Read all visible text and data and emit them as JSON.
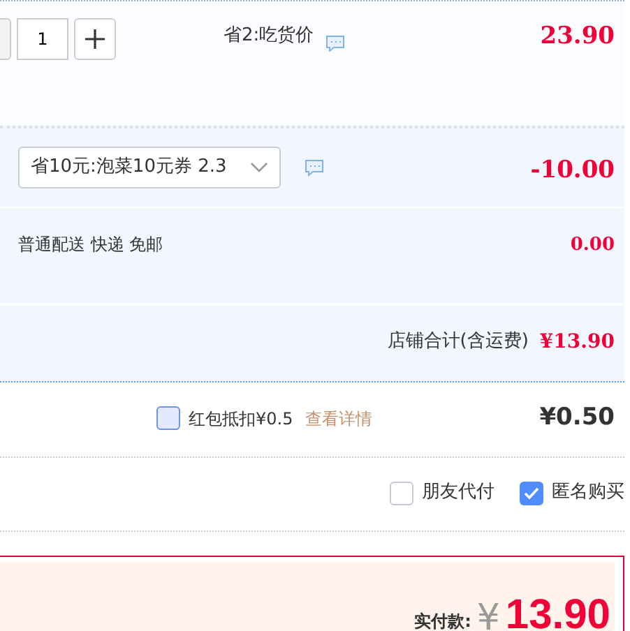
{
  "item": {
    "quantity": "1",
    "promo": "省2:吃货价",
    "price": "23.90"
  },
  "coupon": {
    "value": "省10元:泡菜10元券 2.3",
    "amount": "-10.00"
  },
  "shipping": {
    "label": "普通配送 快递 免邮",
    "amount": "0.00"
  },
  "shop_total": {
    "label": "店铺合计(含运费)",
    "amount": "¥13.90"
  },
  "red_packet": {
    "label": "红包抵扣¥0.5",
    "checked": false,
    "link": "查看详情",
    "amount": "¥0.50"
  },
  "options": [
    {
      "label": "朋友代付",
      "checked": false
    },
    {
      "label": "匿名购买",
      "checked": true
    }
  ],
  "payment": {
    "label": "实付款:",
    "currency": "¥",
    "amount": "13.90"
  }
}
